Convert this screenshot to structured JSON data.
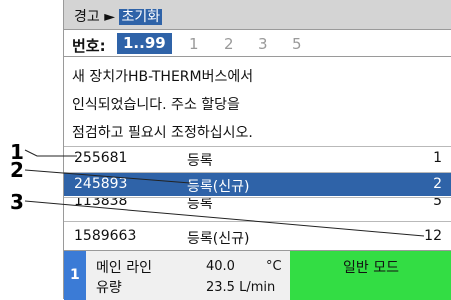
{
  "title_bar": {
    "path": "경고 ► ",
    "current": "초기화"
  },
  "number_bar": {
    "label": "번호:",
    "range": "1..99",
    "pages": [
      "1",
      "2",
      "3",
      "5"
    ]
  },
  "message": [
    "새 장치가HB-THERM버스에서",
    "인식되었습니다. 주소 할당을",
    "점검하고 필요시 조정하십시오."
  ],
  "devices": [
    {
      "number": "255681",
      "status": "등록",
      "index": "1",
      "selected": false
    },
    {
      "number": "245893",
      "status": "등록(신규)",
      "index": "2",
      "selected": true
    },
    {
      "number": "113838",
      "status": "등록",
      "index": "5",
      "selected": false
    },
    {
      "number": "1589663",
      "status": "등록(신규)",
      "index": "12",
      "selected": false
    }
  ],
  "status_bar": {
    "zone": "1",
    "label_line1": "메인 라인",
    "label_line2": "유량",
    "temperature": "40.0",
    "temperature_unit": "°C",
    "flow": "23.5 L/min",
    "mode": "일반 모드"
  },
  "callouts": [
    "1",
    "2",
    "3"
  ],
  "colors": {
    "selection": "#2f63a8",
    "mode_green": "#33dd44",
    "zone_blue": "#3b7bd6",
    "title_gray": "#d4d4d4"
  }
}
